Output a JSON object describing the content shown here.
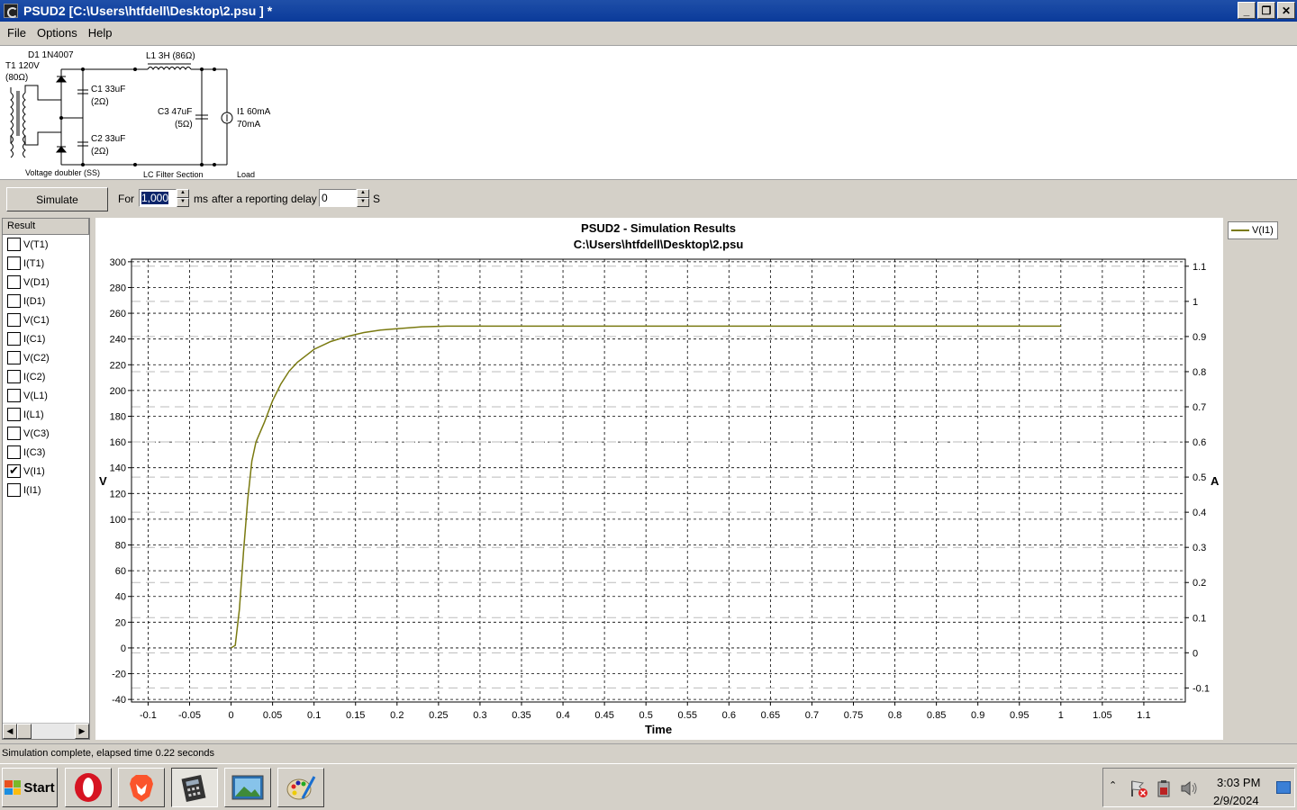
{
  "window": {
    "title": "PSUD2  [C:\\Users\\htfdell\\Desktop\\2.psu ] *"
  },
  "window_buttons": {
    "minimize": "_",
    "restore": "❐",
    "close": "✕"
  },
  "menu": [
    "File",
    "Options",
    "Help"
  ],
  "schematic": {
    "transformer": "T1 120V",
    "transformer_r": "(80Ω)",
    "diode": "D1 1N4007",
    "inductor": "L1 3H (86Ω)",
    "c1": "C1 33uF",
    "c1_r": "(2Ω)",
    "c2": "C2 33uF",
    "c2_r": "(2Ω)",
    "c3": "C3 47uF",
    "c3_r": "(5Ω)",
    "load1": "I1 60mA",
    "load2": "70mA",
    "section1": "Voltage doubler (SS)",
    "section2": "LC Filter Section",
    "section3": "Load"
  },
  "toolbar": {
    "simulate_label": "Simulate",
    "for_label": "For",
    "duration_value": "1,000",
    "ms_label": "ms",
    "delay_label": "after a reporting delay of",
    "delay_value": "0",
    "s_label": "S"
  },
  "results": {
    "header": "Result",
    "items": [
      {
        "label": "V(T1)",
        "checked": false
      },
      {
        "label": "I(T1)",
        "checked": false
      },
      {
        "label": "V(D1)",
        "checked": false
      },
      {
        "label": "I(D1)",
        "checked": false
      },
      {
        "label": "V(C1)",
        "checked": false
      },
      {
        "label": "I(C1)",
        "checked": false
      },
      {
        "label": "V(C2)",
        "checked": false
      },
      {
        "label": "I(C2)",
        "checked": false
      },
      {
        "label": "V(L1)",
        "checked": false
      },
      {
        "label": "I(L1)",
        "checked": false
      },
      {
        "label": "V(C3)",
        "checked": false
      },
      {
        "label": "I(C3)",
        "checked": false
      },
      {
        "label": "V(I1)",
        "checked": true
      },
      {
        "label": "I(I1)",
        "checked": false
      }
    ]
  },
  "chart_data": {
    "type": "line",
    "title": "PSUD2 - Simulation Results",
    "subtitle": "C:\\Users\\htfdell\\Desktop\\2.psu",
    "xlabel": "Time",
    "ylabel": "V",
    "y2label": "A",
    "xlim": [
      -0.12,
      1.15
    ],
    "ylim": [
      -42,
      302
    ],
    "y2lim": [
      -0.14,
      1.12
    ],
    "xticks": [
      -0.1,
      -0.05,
      0,
      0.05,
      0.1,
      0.15,
      0.2,
      0.25,
      0.3,
      0.35,
      0.4,
      0.45,
      0.5,
      0.55,
      0.6,
      0.65,
      0.7,
      0.75,
      0.8,
      0.85,
      0.9,
      0.95,
      1,
      1.05,
      1.1
    ],
    "xtick_labels": [
      "-0.1",
      "-0.05",
      "0",
      "0.05",
      "0.1",
      "0.15",
      "0.2",
      "0.25",
      "0.3",
      "0.35",
      "0.4",
      "0.45",
      "0.5",
      "0.55",
      "0.6",
      "0.65",
      "0.7",
      "0.75",
      "0.8",
      "0.85",
      "0.9",
      "0.95",
      "1",
      "1.05",
      "1.1"
    ],
    "yticks": [
      -40,
      -20,
      0,
      20,
      40,
      60,
      80,
      100,
      120,
      140,
      160,
      180,
      200,
      220,
      240,
      260,
      280,
      300
    ],
    "ytick_labels": [
      "-40",
      "-20",
      "0",
      "20",
      "40",
      "60",
      "80",
      "100",
      "120",
      "140",
      "160",
      "180",
      "200",
      "220",
      "240",
      "260",
      "280",
      "300"
    ],
    "y2ticks": [
      -0.1,
      0,
      0.1,
      0.2,
      0.3,
      0.4,
      0.5,
      0.6,
      0.7,
      0.8,
      0.9,
      1,
      1.1
    ],
    "y2tick_labels": [
      "-0.1",
      "0",
      "0.1",
      "0.2",
      "0.3",
      "0.4",
      "0.5",
      "0.6",
      "0.7",
      "0.8",
      "0.9",
      "1",
      "1.1"
    ],
    "grid": true,
    "legend_position": "right",
    "series": [
      {
        "name": "V(I1)",
        "color": "#7a7a10",
        "x": [
          0,
          0.005,
          0.01,
          0.015,
          0.02,
          0.025,
          0.03,
          0.04,
          0.05,
          0.06,
          0.07,
          0.08,
          0.09,
          0.1,
          0.12,
          0.14,
          0.16,
          0.18,
          0.2,
          0.23,
          0.26,
          0.3,
          0.4,
          0.5,
          0.6,
          0.7,
          0.8,
          0.9,
          1.0
        ],
        "y": [
          0,
          2,
          30,
          75,
          115,
          145,
          160,
          175,
          192,
          205,
          215,
          222,
          227,
          232,
          238,
          242,
          245,
          247,
          248,
          249.5,
          250,
          250,
          250,
          250,
          250,
          250,
          250,
          250,
          250
        ]
      }
    ]
  },
  "status": "Simulation complete, elapsed time 0.22 seconds",
  "taskbar": {
    "start_label": "Start",
    "time": "3:03 PM",
    "date": "2/9/2024"
  }
}
